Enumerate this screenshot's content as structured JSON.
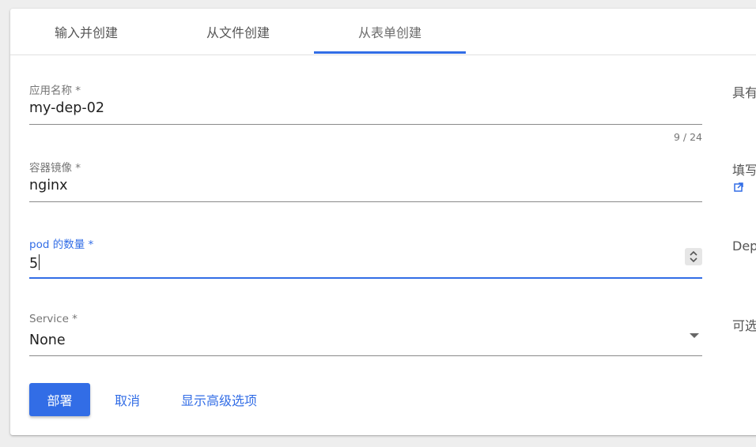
{
  "tabs": [
    {
      "label": "输入并创建"
    },
    {
      "label": "从文件创建"
    },
    {
      "label": "从表单创建",
      "active": true
    }
  ],
  "form": {
    "app_name": {
      "label": "应用名称 *",
      "value": "my-dep-02",
      "counter": "9 / 24"
    },
    "image": {
      "label": "容器镜像 *",
      "value": "nginx"
    },
    "pods": {
      "label": "pod 的数量 *",
      "value": "5"
    },
    "service": {
      "label": "Service *",
      "selected": "None"
    }
  },
  "actions": {
    "deploy": "部署",
    "cancel": "取消",
    "advanced": "显示高级选项"
  },
  "side_help": [
    "具有",
    "填写",
    "Dep",
    "可选"
  ],
  "icons": {
    "external_link": "external-link-icon",
    "spinner": "stepper-arrows-icon",
    "dropdown": "dropdown-arrow-icon"
  },
  "colors": {
    "accent": "#326de6",
    "text": "#212121",
    "label": "#757575"
  }
}
